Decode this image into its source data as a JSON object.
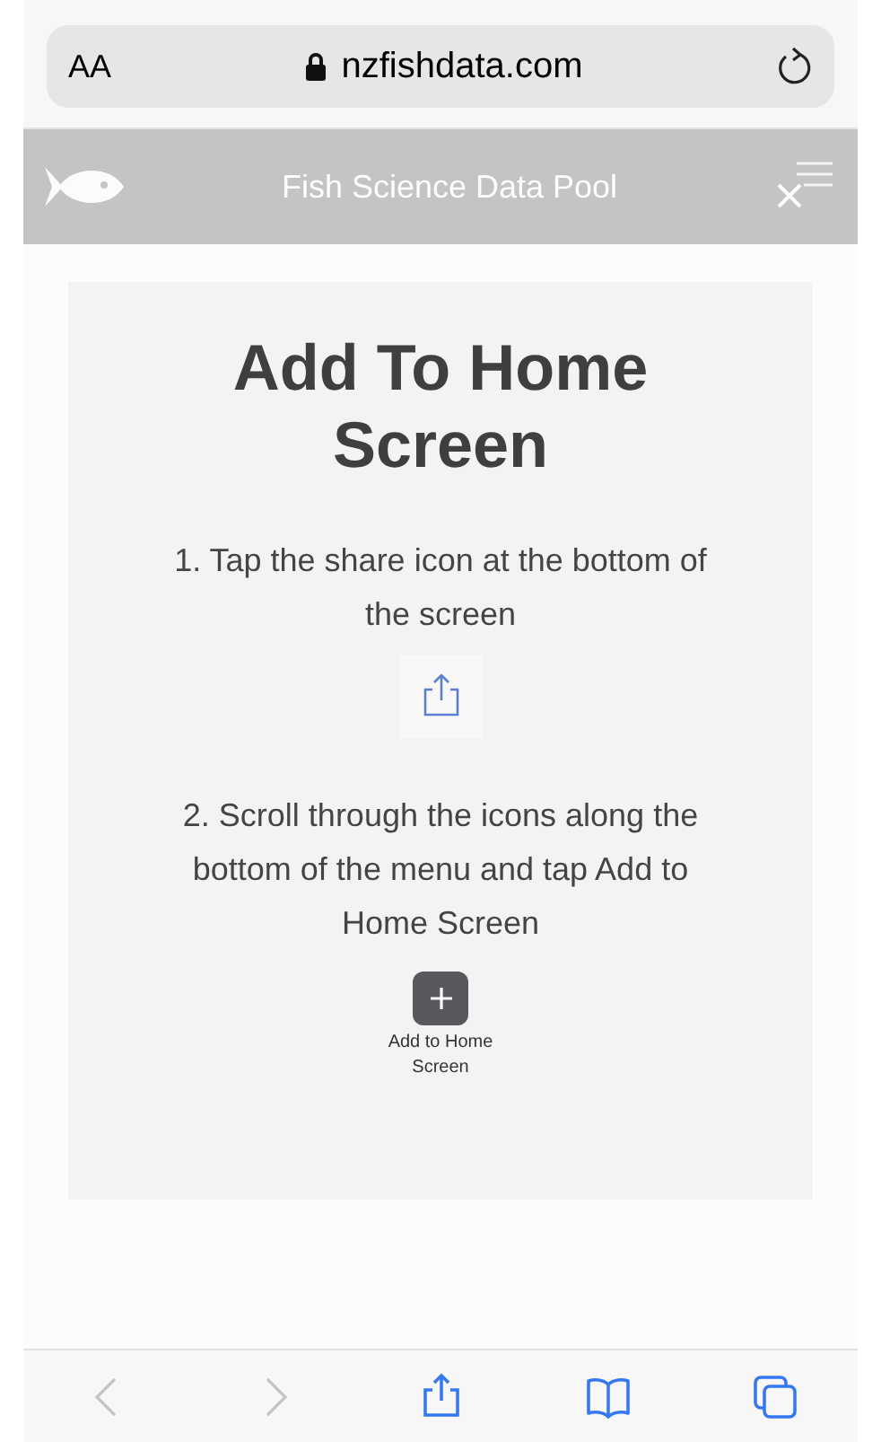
{
  "address_bar": {
    "text_size_label": "AA",
    "url": "nzfishdata.com"
  },
  "site_header": {
    "title": "Fish Science Data Pool"
  },
  "modal": {
    "title": "Add To Home Screen",
    "steps": [
      {
        "kind": "share",
        "text": "1. Tap the share icon at the bottom of the screen"
      },
      {
        "kind": "add",
        "text": "2. Scroll through the icons along the bottom of the menu and tap Add to Home Screen",
        "icon_caption": "Add to Home Screen"
      }
    ]
  },
  "toolbar": [
    {
      "kind": "back",
      "disabled": true
    },
    {
      "kind": "forward",
      "disabled": true
    },
    {
      "kind": "share",
      "disabled": false
    },
    {
      "kind": "bookmarks",
      "disabled": false
    },
    {
      "kind": "tabs",
      "disabled": false
    }
  ]
}
